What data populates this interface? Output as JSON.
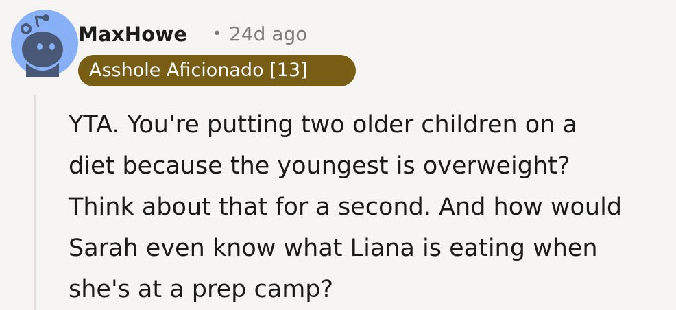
{
  "comment": {
    "author": {
      "username": "MaxHowe",
      "avatar_icon": "snoo-avatar-icon"
    },
    "separator": "•",
    "timestamp": "24d ago",
    "flair": {
      "text": "Asshole Aficionado [13]",
      "background": "#775e14",
      "color": "#ffffff"
    },
    "body": "YTA. You're putting two older children on a\ndiet because the youngest is overweight?\nThink about that for a second. And how would\nSarah even know what Liana is eating when\nshe's at a prep camp?"
  },
  "colors": {
    "background": "#f6f5f4",
    "avatar_bg": "#88b0f6",
    "thread_line": "#e6dfd9",
    "meta_text": "#7c7c7c"
  }
}
